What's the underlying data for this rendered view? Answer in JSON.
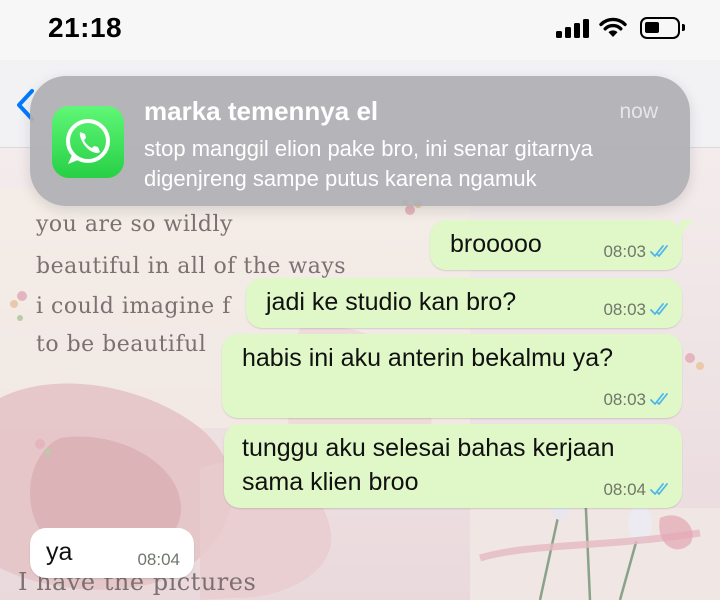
{
  "status_bar": {
    "time": "21:18",
    "signal_icon": "cellular-signal-icon",
    "wifi_icon": "wifi-icon",
    "battery_icon": "battery-icon"
  },
  "header": {
    "back_icon": "chevron-left-icon"
  },
  "notification": {
    "app_icon": "whatsapp-icon",
    "title": "marka temennya el",
    "time": "now",
    "body": "stop manggil elion pake bro, ini senar gitarnya digenjreng sampe putus karena ngamuk"
  },
  "wallpaper": {
    "lines": [
      "you are so wildly",
      "beautiful in all of  the ways",
      "i could imagine f",
      "to be beautiful",
      "I have the pictures"
    ]
  },
  "messages": [
    {
      "direction": "out",
      "text_lines": [
        "brooooo"
      ],
      "time": "08:03",
      "status": "read"
    },
    {
      "direction": "out",
      "text_lines": [
        "jadi ke studio kan bro?"
      ],
      "time": "08:03",
      "status": "read"
    },
    {
      "direction": "out",
      "text_lines": [
        "habis ini aku anterin bekalmu ya?"
      ],
      "time": "08:03",
      "status": "read"
    },
    {
      "direction": "out",
      "text_lines": [
        "tunggu aku selesai bahas kerjaan",
        "sama klien broo"
      ],
      "time": "08:04",
      "status": "read"
    },
    {
      "direction": "in",
      "text_lines": [
        "ya"
      ],
      "time": "08:04"
    }
  ],
  "colors": {
    "outgoing_bubble": "#e0f8c7",
    "incoming_bubble": "#ffffff",
    "read_ticks": "#4fb6ec",
    "whatsapp_green": "#27d045",
    "ios_blue": "#007aff"
  }
}
